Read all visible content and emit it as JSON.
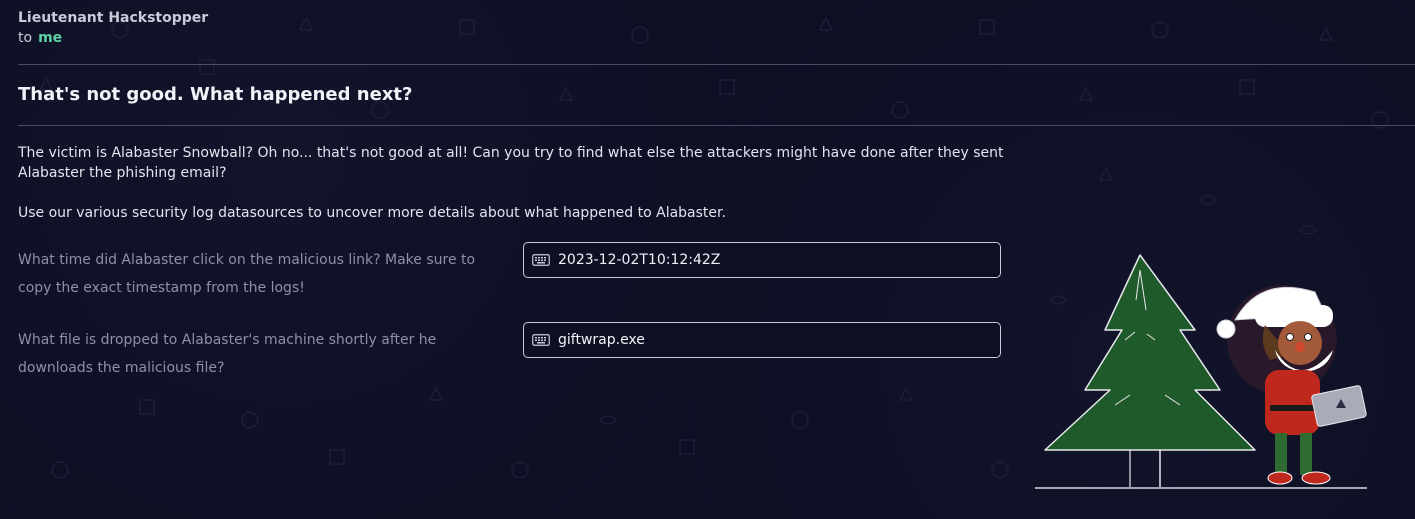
{
  "message": {
    "sender": "Lieutenant Hackstopper",
    "to_label": "to",
    "recipient": "me"
  },
  "content": {
    "title": "That's not good. What happened next?",
    "paragraph1": "The victim is Alabaster Snowball? Oh no... that's not good at all! Can you try to find what else the attackers might have done after they sent Alabaster the phishing email?",
    "paragraph2": "Use our various security log datasources to uncover more details about what happened to Alabaster."
  },
  "questions": [
    {
      "label": "What time did Alabaster click on the malicious link? Make sure to copy the exact timestamp from the logs!",
      "answer": "2023-12-02T10:12:42Z",
      "icon": "keyboard-icon"
    },
    {
      "label": "What file is dropped to Alabaster's machine shortly after he downloads the malicious file?",
      "answer": "giftwrap.exe",
      "icon": "keyboard-icon"
    }
  ],
  "colors": {
    "background": "#0d0f23",
    "accent": "#5fd3a6",
    "muted_text": "#8d90a8",
    "border": "#c9cbd8"
  }
}
